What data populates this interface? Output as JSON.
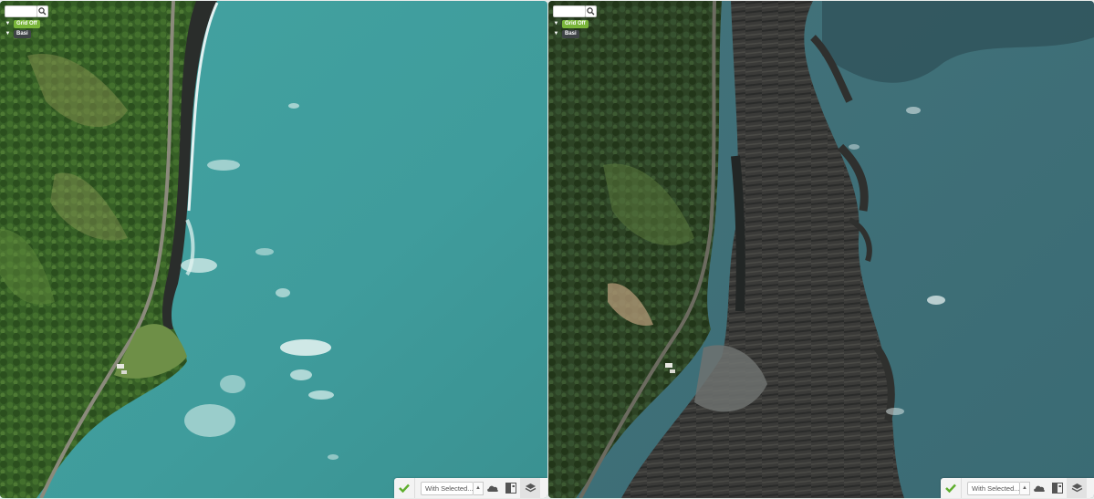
{
  "panes": [
    {
      "id": "left",
      "imagery": "satellite-coastline-before",
      "controls": {
        "search": {
          "value": "",
          "placeholder": ""
        },
        "grid_label": "Grid Off",
        "basemap_label": "Basi"
      },
      "toolbar": {
        "select_label": "With Selected...",
        "icons": [
          "check-icon",
          "cloud-icon",
          "compare-icon",
          "layers-icon"
        ]
      }
    },
    {
      "id": "right",
      "imagery": "satellite-coastline-after-uplift",
      "controls": {
        "search": {
          "value": "",
          "placeholder": ""
        },
        "grid_label": "Grid Off",
        "basemap_label": "Basi"
      },
      "toolbar": {
        "select_label": "With Selected...",
        "icons": [
          "check-icon",
          "cloud-icon",
          "compare-icon",
          "layers-icon"
        ]
      }
    }
  ],
  "colors": {
    "accent_green": "#79b53a",
    "dark_pill": "#3f4447",
    "sea_left": "#46a2a2",
    "sea_right": "#3d6e77",
    "land_left": "#3e6a2c",
    "land_right": "#2f4426"
  }
}
